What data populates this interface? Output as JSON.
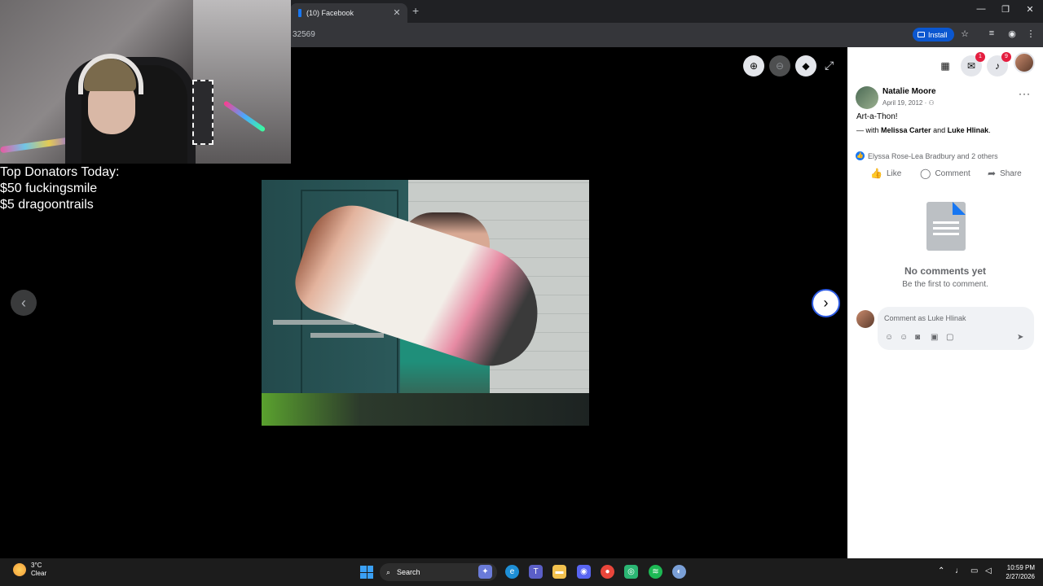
{
  "browser": {
    "tab_title": "(10) Facebook",
    "tab_close": "✕",
    "new_tab": "+",
    "url_fragment": "32569",
    "install_label": "Install",
    "window_controls": {
      "minimize": "—",
      "restore": "❐",
      "close": "✕"
    }
  },
  "stream_overlay": {
    "heading": "Top Donators Today:",
    "donators": [
      "$50 fuckingsmile",
      "$5 dragoontrails"
    ]
  },
  "post": {
    "author": "Natalie Moore",
    "date": "April 19, 2012 ·",
    "caption": "Art-a-Thon!",
    "with_prefix": "— with ",
    "tagged_1": "Melissa Carter",
    "and": " and ",
    "tagged_2": "Luke Hlinak",
    "period": ".",
    "reactions": "Elyssa Rose-Lea Bradbury and 2 others",
    "more": "···"
  },
  "actions": {
    "like": "Like",
    "comment": "Comment",
    "share": "Share"
  },
  "comments": {
    "empty_title": "No comments yet",
    "empty_sub": "Be the first to comment.",
    "placeholder": "Comment as Luke Hlinak"
  },
  "top_nav": {
    "messenger_badge": "1",
    "notifications_badge": "9"
  },
  "taskbar": {
    "temp": "3°C",
    "condition": "Clear",
    "search": "Search",
    "time": "10:59 PM",
    "date": "2/27/2026"
  }
}
